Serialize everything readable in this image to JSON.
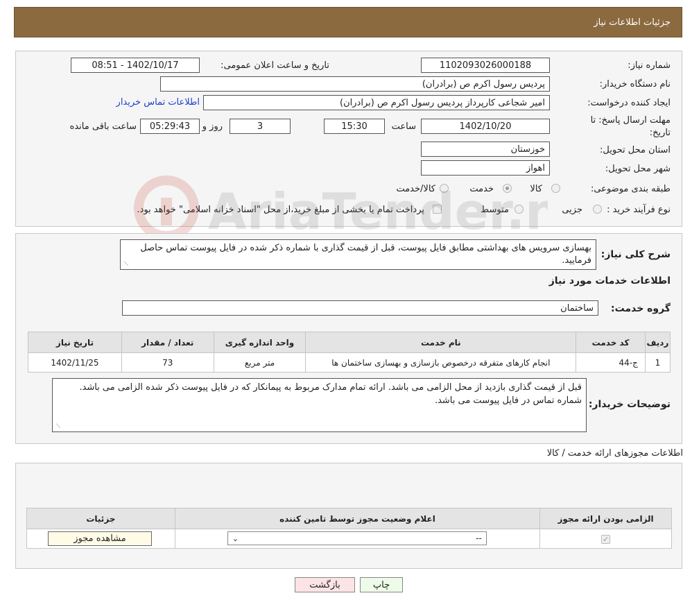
{
  "header": {
    "title": "جزئیات اطلاعات نیاز"
  },
  "info": {
    "need_number_label": "شماره نیاز:",
    "need_number": "1102093026000188",
    "announce_label": "تاریخ و ساعت اعلان عمومی:",
    "announce_value": "1402/10/17 - 08:51",
    "buyer_org_label": "نام دستگاه خریدار:",
    "buyer_org": "پردیس رسول اکرم ص (برادران)",
    "requester_label": "ایجاد کننده درخواست:",
    "requester": "امیر  شجاعی کارپرداز پردیس رسول اکرم ص (برادران)",
    "contact_link": "اطلاعات تماس خریدار",
    "deadline_label_1": "مهلت ارسال پاسخ: تا",
    "deadline_label_2": "تاریخ:",
    "deadline_date": "1402/10/20",
    "time_label": "ساعت",
    "deadline_time": "15:30",
    "days_value": "3",
    "days_label": "روز و",
    "remaining_time": "05:29:43",
    "remaining_label": "ساعت باقی مانده",
    "province_label": "استان محل تحویل:",
    "province": "خوزستان",
    "city_label": "شهر محل تحویل:",
    "city": "اهواز",
    "category_label": "طبقه بندی موضوعی:",
    "category_options": [
      {
        "label": "کالا",
        "checked": false
      },
      {
        "label": "خدمت",
        "checked": true
      },
      {
        "label": "کالا/خدمت",
        "checked": false
      }
    ],
    "process_label": "نوع فرآیند خرید :",
    "process_options": [
      {
        "label": "جزیی",
        "checked": false
      },
      {
        "label": "متوسط",
        "checked": false
      }
    ],
    "process_note": "پرداخت تمام یا بخشی از مبلغ خرید،از محل \"اسناد خزانه اسلامی\" خواهد بود."
  },
  "description": {
    "label": "شرح کلی نیاز:",
    "text": "بهسازی سرویس های بهداشتی مطابق فایل پیوست، قبل از قیمت گذاری با شماره ذکر شده در فایل پیوست تماس حاصل فرمایید."
  },
  "services": {
    "section_title": "اطلاعات خدمات مورد نیاز",
    "group_label": "گروه خدمت:",
    "group_value": "ساختمان",
    "columns": [
      "ردیف",
      "کد خدمت",
      "نام خدمت",
      "واحد اندازه گیری",
      "تعداد / مقدار",
      "تاریخ نیاز"
    ],
    "rows": [
      [
        "1",
        "ج-44",
        "انجام کارهای متفرقه درخصوص بازسازی و بهسازی ساختمان ها",
        "متر مربع",
        "73",
        "1402/11/25"
      ]
    ]
  },
  "buyer_notes": {
    "label": "توضیحات خریدار:",
    "text": "قبل از قیمت گذاری بازدید از محل الزامی می باشد. ارائه تمام مدارک مربوط به پیمانکار که در فایل پیوست ذکر شده الزامی می باشد. شماره تماس در فایل پیوست می باشد."
  },
  "permits": {
    "section_title": "اطلاعات مجوزهای ارائه خدمت / کالا",
    "columns": [
      "الزامی بودن ارائه مجوز",
      "اعلام وضعیت مجوز توسط تامین کننده",
      "جزئیات"
    ],
    "select_value": "--",
    "view_button": "مشاهده مجوز",
    "required_checked": true
  },
  "actions": {
    "print": "چاپ",
    "back": "بازگشت"
  },
  "watermark": "AriaTender.neT"
}
